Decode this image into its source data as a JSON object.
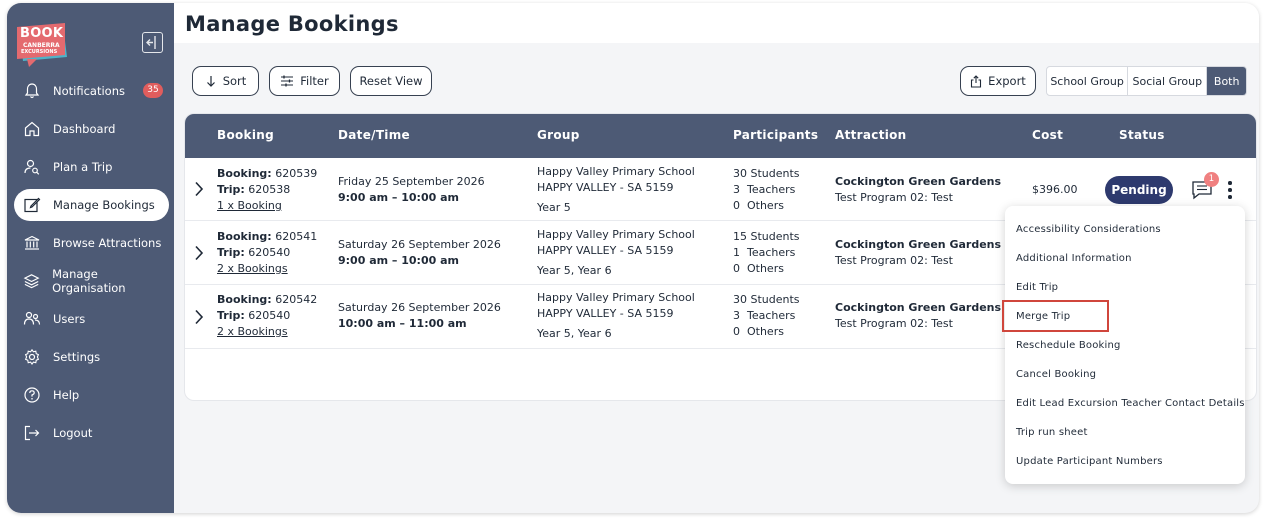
{
  "brand": {
    "logo_line1": "BOOK",
    "logo_line2": "CANBERRA",
    "logo_line3": "EXCURSIONS",
    "accent": "#e05d5d",
    "sidebar_color": "#4d5a75",
    "primary": "#2e3a6e",
    "highlight": "#d0463c"
  },
  "sidebar": {
    "collapse_icon": "collapse-sidebar-icon",
    "notifications_count": "35",
    "items": [
      {
        "label": "Notifications",
        "icon": "bell-icon"
      },
      {
        "label": "Dashboard",
        "icon": "home-icon"
      },
      {
        "label": "Plan a Trip",
        "icon": "user-search-icon"
      },
      {
        "label": "Manage Bookings",
        "icon": "edit-icon"
      },
      {
        "label": "Browse Attractions",
        "icon": "building-icon"
      },
      {
        "label": "Manage Organisation",
        "icon": "layers-icon"
      },
      {
        "label": "Users",
        "icon": "users-icon"
      },
      {
        "label": "Settings",
        "icon": "gear-icon"
      },
      {
        "label": "Help",
        "icon": "help-icon"
      },
      {
        "label": "Logout",
        "icon": "logout-icon"
      }
    ]
  },
  "page": {
    "title": "Manage Bookings"
  },
  "toolbar": {
    "sort_label": "Sort",
    "filter_label": "Filter",
    "reset_label": "Reset View",
    "export_label": "Export",
    "segments": [
      "School Group",
      "Social Group",
      "Both"
    ],
    "selected_segment": "Both"
  },
  "table": {
    "headers": [
      "Booking",
      "Date/Time",
      "Group",
      "Participants",
      "Attraction",
      "Cost",
      "Status"
    ],
    "rows": [
      {
        "booking_label": "Booking:",
        "booking_id": "620539",
        "trip_label": "Trip:",
        "trip_id": "620538",
        "link": "1 x Booking",
        "date": "Friday 25 September 2026",
        "time": "9:00 am – 10:00 am",
        "school": "Happy Valley Primary School",
        "location": "HAPPY VALLEY - SA 5159",
        "years": "Year 5",
        "students": "30 Students",
        "teachers": "3  Teachers",
        "others": "0  Others",
        "attraction": "Cockington Green Gardens",
        "program": "Test Program 02: Test",
        "cost": "$396.00",
        "status": "Pending",
        "message_count": "1"
      },
      {
        "booking_label": "Booking:",
        "booking_id": "620541",
        "trip_label": "Trip:",
        "trip_id": "620540",
        "link": "2 x Bookings",
        "date": "Saturday 26 September 2026",
        "time": "9:00 am – 10:00 am",
        "school": "Happy Valley Primary School",
        "location": "HAPPY VALLEY - SA 5159",
        "years": "Year 5, Year 6",
        "students": "15 Students",
        "teachers": "1  Teachers",
        "others": "0  Others",
        "attraction": "Cockington Green Gardens",
        "program": "Test Program 02: Test"
      },
      {
        "booking_label": "Booking:",
        "booking_id": "620542",
        "trip_label": "Trip:",
        "trip_id": "620540",
        "link": "2 x Bookings",
        "date": "Saturday 26 September 2026",
        "time": "10:00 am – 11:00 am",
        "school": "Happy Valley Primary School",
        "location": "HAPPY VALLEY - SA 5159",
        "years": "Year 5, Year 6",
        "students": "30 Students",
        "teachers": "3  Teachers",
        "others": "0  Others",
        "attraction": "Cockington Green Gardens",
        "program": "Test Program 02: Test"
      }
    ]
  },
  "context_menu": {
    "items": [
      "Accessibility Considerations",
      "Additional Information",
      "Edit Trip",
      "Merge Trip",
      "Reschedule Booking",
      "Cancel Booking",
      "Edit Lead Excursion Teacher Contact Details",
      "Trip run sheet",
      "Update Participant Numbers"
    ],
    "highlighted_item": "Merge Trip"
  }
}
